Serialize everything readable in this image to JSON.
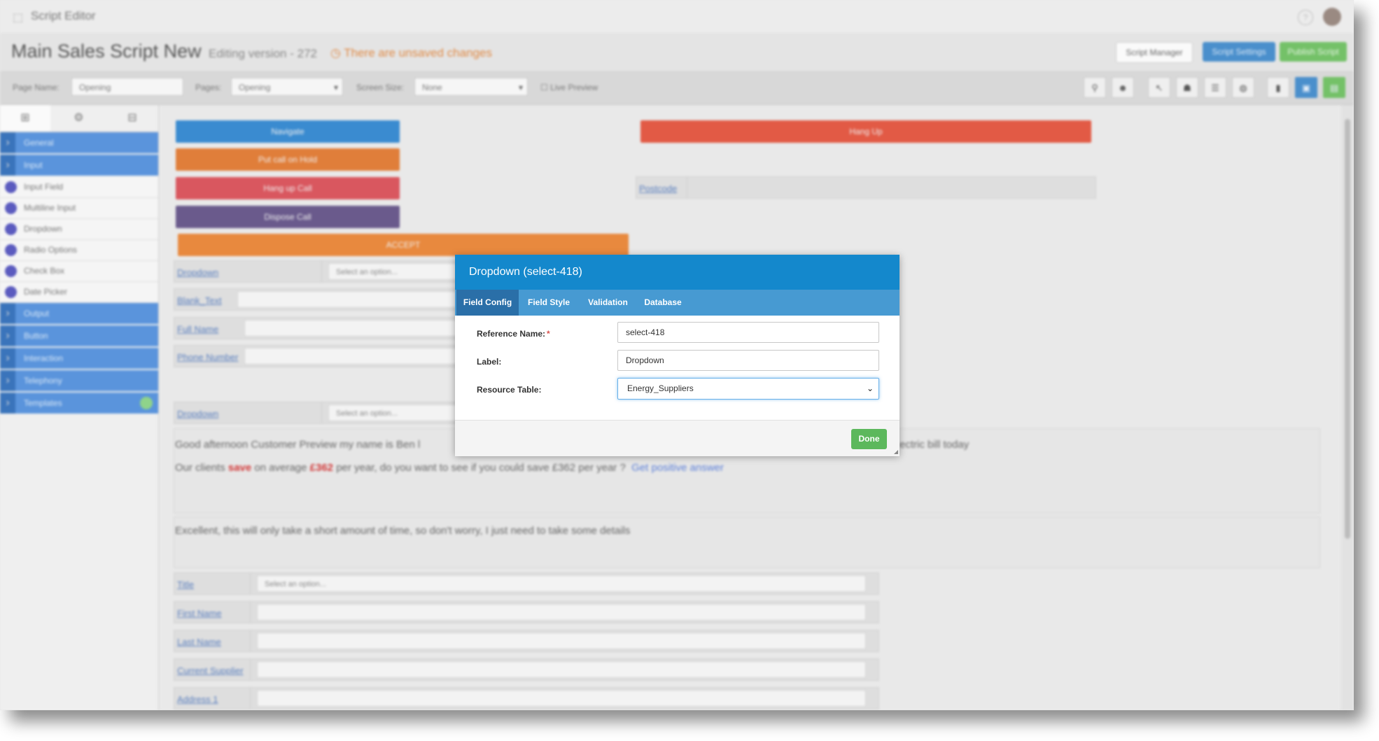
{
  "app": {
    "title": "Script Editor",
    "help_icon": "question-icon"
  },
  "header": {
    "script_title": "Main Sales Script New",
    "editing_version": "Editing version - 272",
    "unsaved": "There are unsaved changes",
    "buttons": {
      "manager": "Script Manager",
      "settings": "Script Settings",
      "publish": "Publish Script"
    }
  },
  "toolbar": {
    "page_name_label": "Page Name:",
    "page_name_value": "Opening",
    "pages_label": "Pages:",
    "pages_value": "Opening",
    "screen_size_label": "Screen Size:",
    "screen_size_value": "None",
    "live_preview": "Live Preview"
  },
  "sidebar": {
    "categories": {
      "general": "General",
      "input": "Input",
      "output": "Output",
      "button": "Button",
      "interaction": "Interaction",
      "telephony": "Telephony",
      "templates": "Templates"
    },
    "input_items": [
      "Input Field",
      "Multiline Input",
      "Dropdown",
      "Radio Options",
      "Check Box",
      "Date Picker"
    ]
  },
  "canvas": {
    "buttons": {
      "navigate": "Navigate",
      "hold": "Put call on Hold",
      "hangup_call": "Hang up Call",
      "dispose": "Dispose Call",
      "hangup": "Hang Up"
    },
    "accept_bar": "ACCEPT",
    "postcode_label": "Postcode",
    "dropdown_label": "Dropdown",
    "blank_text_label": "Blank_Text",
    "full_name_label": "Full Name",
    "phone_label": "Phone Number",
    "select_placeholder": "Select an option...",
    "text_line1": "Good afternoon Customer Preview my name is Ben l",
    "text_line1_end": "ectric bill today",
    "text_line2_a": "Our clients",
    "text_line2_save": "save",
    "text_line2_b": "on average",
    "text_line2_amount": "£362",
    "text_line2_c": "per year, do you want to see if you could save £362 per year ?",
    "text_line2_link": "Get positive answer",
    "text_line3": "Excellent, this will only take a short amount of time, so don't worry, I just need to take some details",
    "title_label": "Title",
    "first_name_label": "First Name",
    "last_name_label": "Last Name",
    "current_supplier_label": "Current Supplier",
    "address_label": "Address 1"
  },
  "dialog": {
    "title": "Dropdown (select-418)",
    "tabs": [
      "Field Config",
      "Field Style",
      "Validation",
      "Database"
    ],
    "active_tab": "Field Config",
    "reference_label": "Reference Name:",
    "required_mark": "*",
    "reference_value": "select-418",
    "label_label": "Label:",
    "label_value": "Dropdown",
    "resource_label": "Resource Table:",
    "resource_value": "Energy_Suppliers",
    "done": "Done"
  },
  "colors": {
    "dialog_header": "#1488cc",
    "dialog_tabs": "#479ad2",
    "done_green": "#5cb85c",
    "sidebar_blue": "#5a94dc",
    "unsaved_orange": "#e08a45"
  }
}
